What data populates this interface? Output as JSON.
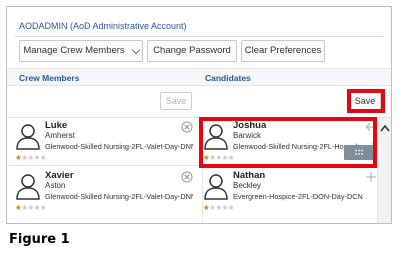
{
  "header": {
    "account_title": "AODADMIN (AoD Administrative Account)"
  },
  "toolbar": {
    "manage_crew_label": "Manage Crew Members",
    "change_password_label": "Change Password",
    "clear_preferences_label": "Clear Preferences"
  },
  "sections": {
    "crew_label": "Crew Members",
    "candidates_label": "Candidates"
  },
  "crew": {
    "save_label": "Save",
    "members": [
      {
        "first": "Luke",
        "last": "Amherst",
        "unit": "Glenwood-Skilled Nursing-2FL-Valet-Day-DNN",
        "rating": 1,
        "action_icon": "close-circle-icon"
      },
      {
        "first": "Xavier",
        "last": "Aston",
        "unit": "Glenwood-Skilled Nursing-2FL-Valet-Day-DNN",
        "rating": 1,
        "action_icon": "close-circle-icon"
      }
    ]
  },
  "candidates": {
    "save_label": "Save",
    "members": [
      {
        "first": "Joshua",
        "last": "Barwick",
        "unit": "Glenwood-Skilled Nursing-2FL-Housekeeping-D",
        "rating": 1,
        "action_icon": "arrow-left-icon"
      },
      {
        "first": "Nathan",
        "last": "Beckley",
        "unit": "Evergreen-Hospice-2FL-DON-Day-DCN",
        "rating": 1,
        "action_icon": "plus-icon"
      }
    ]
  },
  "caption": "Figure 1",
  "colors": {
    "highlight": "#e30613",
    "link_blue": "#2b5797",
    "star": "#d77f1e"
  }
}
